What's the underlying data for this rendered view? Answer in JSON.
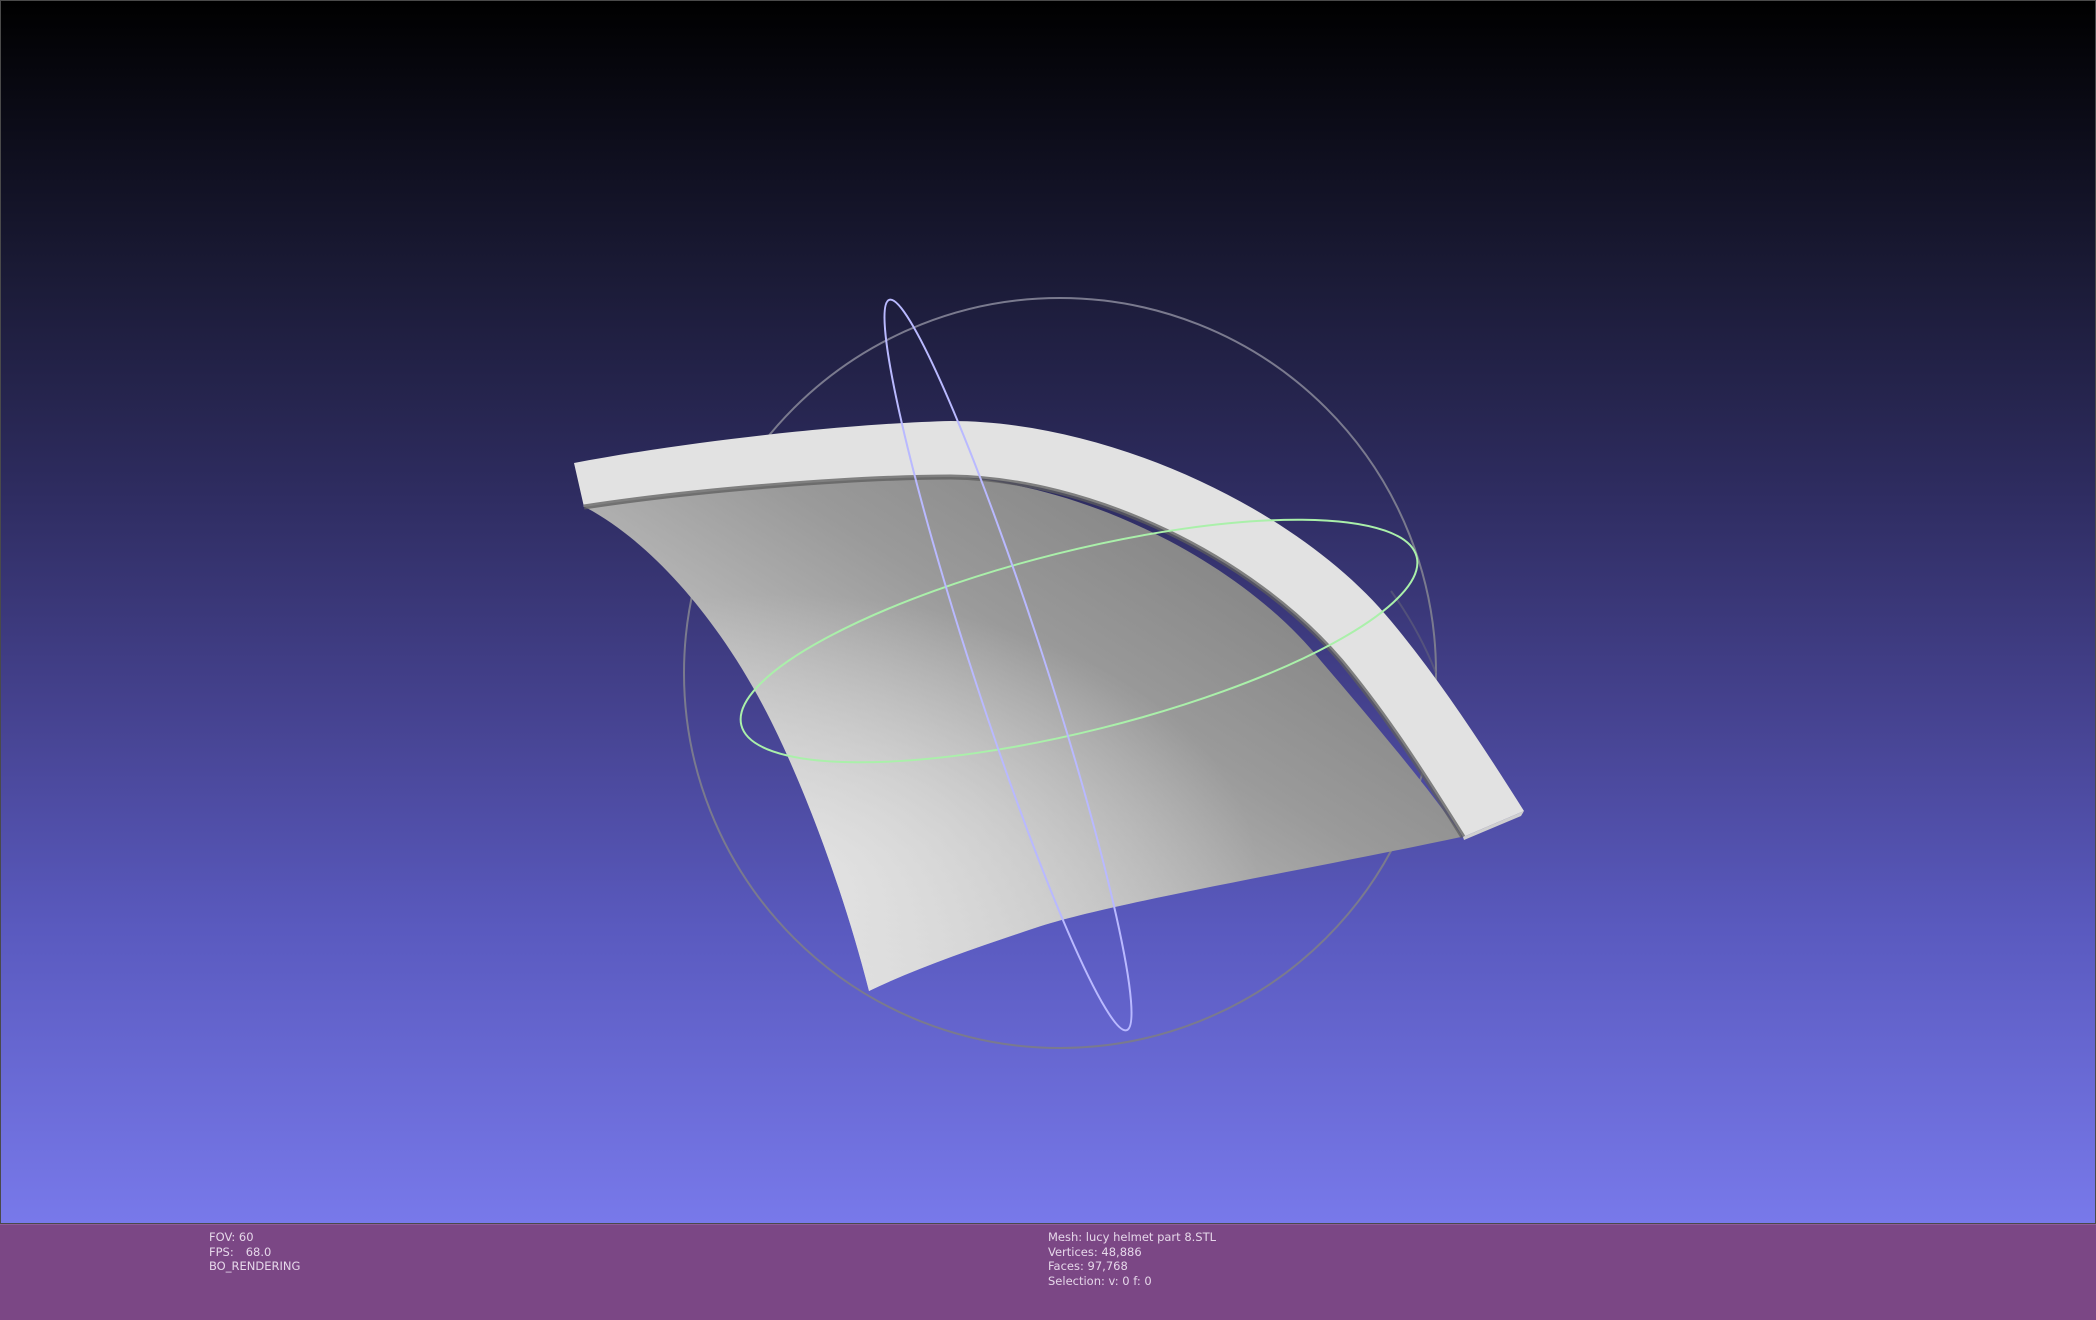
{
  "viewer": {
    "colors": {
      "background_top": "#000000",
      "background_bottom": "#7879ea",
      "info_bar": "#7b4785",
      "mesh_face_light": "#e3e3e3",
      "mesh_face_shade": "#8a8a8a",
      "trackball_outer": "#7c7c90",
      "trackball_vertical": "#b9b9ff",
      "trackball_horizontal": "#aaf0aa"
    },
    "trackball": {
      "rings": [
        "trackball-outer-ring",
        "trackball-vertical-ring",
        "trackball-horizontal-ring"
      ]
    }
  },
  "info_left": {
    "fov_label": "FOV: 60",
    "fps_label": "FPS:",
    "fps_value": "68.0",
    "render_mode": "BO_RENDERING"
  },
  "info_right": {
    "mesh": "Mesh: lucy helmet part 8.STL",
    "vertices": "Vertices: 48,886",
    "faces": "Faces: 97,768",
    "selection": "Selection: v: 0 f: 0"
  }
}
